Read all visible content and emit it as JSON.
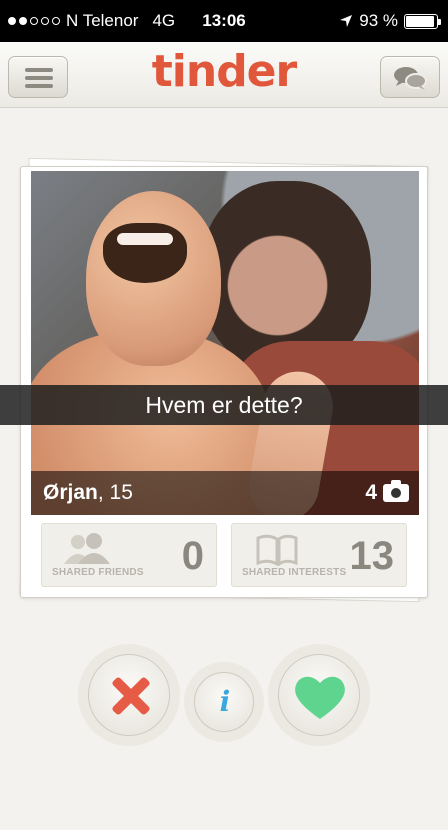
{
  "status_bar": {
    "carrier": "N Telenor",
    "network": "4G",
    "time": "13:06",
    "battery": "93 %",
    "battery_level": 0.93,
    "signal_bars": 2
  },
  "header": {
    "logo": "tinder",
    "menu_icon": "hamburger-icon",
    "chat_icon": "chat-bubbles-icon",
    "brand_color": "#e0573b"
  },
  "card": {
    "name": "Ørjan",
    "age": ", 15",
    "photo_count": "4",
    "caption": "Hvem er dette?",
    "shared_friends_label": "SHARED FRIENDS",
    "shared_friends_count": "0",
    "shared_interests_label": "SHARED INTERESTS",
    "shared_interests_count": "13"
  },
  "actions": {
    "nope_icon": "x-icon",
    "info_icon": "info-icon",
    "like_icon": "heart-icon",
    "nope_color": "#e55b46",
    "info_color": "#3aa7df",
    "like_color": "#5fd48f"
  }
}
